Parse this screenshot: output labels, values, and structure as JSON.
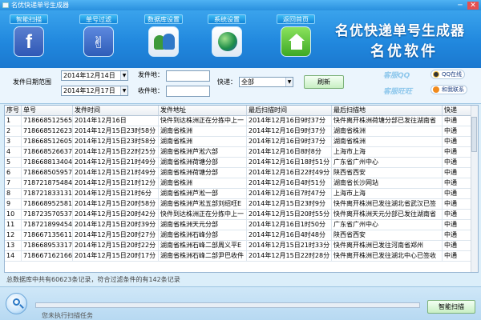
{
  "window": {
    "title": "名优快递单号生成器",
    "controls": [
      "─",
      "✕"
    ]
  },
  "nav": [
    {
      "label": "智能扫描",
      "icon": "facebook-icon",
      "glyph": "f"
    },
    {
      "label": "单号过滤",
      "icon": "msn-icon",
      "glyph": "✌"
    },
    {
      "label": "数据库设置",
      "icon": "users-icon",
      "glyph": ""
    },
    {
      "label": "系统设置",
      "icon": "globe-icon",
      "glyph": ""
    },
    {
      "label": "返回首页",
      "icon": "home-icon",
      "glyph": ""
    }
  ],
  "brand": {
    "title": "名优快递单号生成器",
    "subtitle": "名优软件"
  },
  "filters": {
    "date_label": "发件日期范围",
    "date_from": "2014年12月14日",
    "date_to": "2014年12月17日",
    "from_label": "发件地：",
    "to_label": "收件地：",
    "express_label": "快递：",
    "express_value": "全部",
    "refresh": "刷新",
    "kefu_qq": "客服QQ",
    "kefu_ww": "客服旺旺",
    "qq_online": "QQ在线",
    "wangwang": "和我联系"
  },
  "table": {
    "columns": [
      "序号",
      "单号",
      "发件时间",
      "发件地址",
      "最后扫描时间",
      "最后扫描地",
      "快递"
    ],
    "rows": [
      [
        "1",
        "718668512565",
        "2014年12月16日",
        "快件到达株洲正在分拣中上一",
        "2014年12月16日9时37分",
        "快件离开株洲荷塘分部已发往湖南省",
        "中通"
      ],
      [
        "2",
        "718668512623",
        "2014年12月15日23时58分",
        "湖南省株洲",
        "2014年12月16日9时37分",
        "湖南省株洲",
        "中通"
      ],
      [
        "3",
        "718668512605",
        "2014年12月15日23时58分",
        "湖南省株洲",
        "2014年12月16日9时37分",
        "湖南省株洲",
        "中通"
      ],
      [
        "4",
        "718668526637",
        "2014年12月15日22时25分",
        "湖南省株洲芦淞六部",
        "2014年12月16日8时8分",
        "上海市上海",
        "中通"
      ],
      [
        "5",
        "718668813404",
        "2014年12月15日21时49分",
        "湖南省株洲荷塘分部",
        "2014年12月16日18时51分",
        "广东省广州中心",
        "中通"
      ],
      [
        "6",
        "718668505957",
        "2014年12月15日21时49分",
        "湖南省株洲荷塘分部",
        "2014年12月16日22时49分",
        "陕西省西安",
        "中通"
      ],
      [
        "7",
        "718721875484",
        "2014年12月15日21时12分",
        "湖南省株洲",
        "2014年12月16日4时51分",
        "湖南省长沙网站",
        "中通"
      ],
      [
        "8",
        "718721833131",
        "2014年12月15日21时6分",
        "湖南省株洲芦淞一部",
        "2014年12月16日7时47分",
        "上海市上海",
        "中通"
      ],
      [
        "9",
        "718668952581",
        "2014年12月15日20时58分",
        "湖南省株洲芦淞五部刘绍旺E",
        "2014年12月15日23时9分",
        "快件离开株洲已发往湖北省武汉已签",
        "中通"
      ],
      [
        "10",
        "718723570537",
        "2014年12月15日20时42分",
        "快件到达株洲正在分拣中上一",
        "2014年12月15日20时55分",
        "快件离开株洲天元分部已发往湖南省",
        "中通"
      ],
      [
        "11",
        "718721899454",
        "2014年12月15日20时39分",
        "湖南省株洲天元分部",
        "2014年12月16日1时50分",
        "广东省广州中心",
        "中通"
      ],
      [
        "12",
        "718667135611",
        "2014年12月15日20时27分",
        "湖南省株洲石峰分部",
        "2014年12月16日4时48分",
        "陕西省西安",
        "中通"
      ],
      [
        "13",
        "718668953317",
        "2014年12月15日20时22分",
        "湖南省株洲石峰二部周义平E",
        "2014年12月15日21时33分",
        "快件离开株洲已发往河南省郑州",
        "中通"
      ],
      [
        "14",
        "718667162166",
        "2014年12月15日20时17分",
        "湖南省株洲石峰二部尹巴收件",
        "2014年12月15日22时28分",
        "快件离开株洲已发往湖北中心已签收",
        "中通"
      ]
    ]
  },
  "status": {
    "summary": "总数据库中共有60623条记录，符合过滤条件的有142条记录",
    "progress": 0,
    "idle": "您未执行扫描任务",
    "scan_button": "智能扫描"
  }
}
